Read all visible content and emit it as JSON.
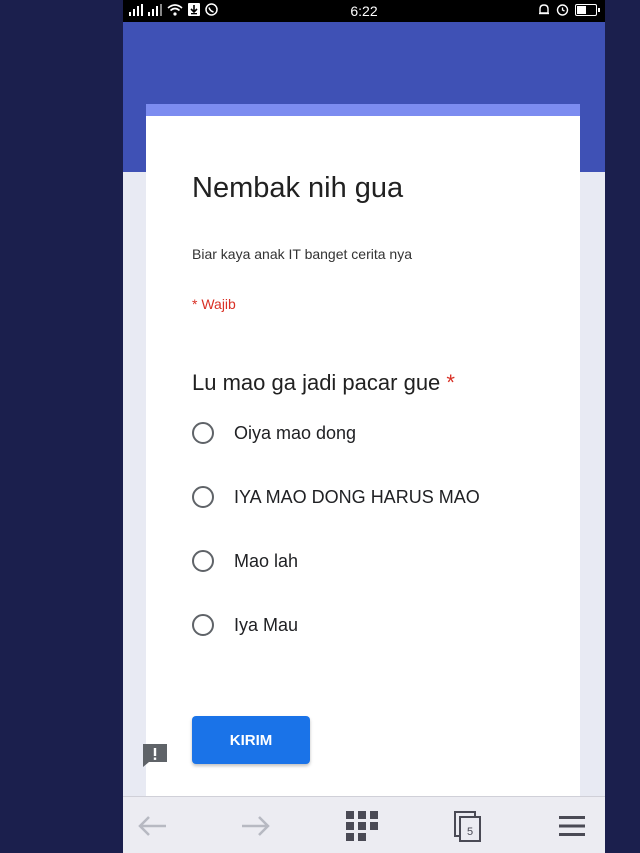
{
  "status_bar": {
    "time": "6:22",
    "left_icons": [
      "signal-icon",
      "signal-icon",
      "wifi-icon",
      "download-icon",
      "whatsapp-icon"
    ],
    "right_icons": [
      "bell-icon",
      "alarm-icon",
      "battery-icon"
    ]
  },
  "form": {
    "title": "Nembak nih gua",
    "description": "Biar kaya anak IT banget cerita nya",
    "required_note": "* Wajib",
    "question": {
      "text": "Lu mao ga jadi pacar gue",
      "required_mark": "*",
      "options": [
        {
          "label": "Oiya mao dong",
          "selected": false
        },
        {
          "label": "IYA MAO DONG HARUS MAO",
          "selected": false
        },
        {
          "label": "Mao lah",
          "selected": false
        },
        {
          "label": "Iya Mau",
          "selected": false
        }
      ]
    },
    "submit_label": "KIRIM"
  },
  "navbar": {
    "tab_count": "5",
    "buttons": [
      "back-arrow-icon",
      "forward-arrow-icon",
      "grid-icon",
      "tabs-icon",
      "menu-icon"
    ]
  },
  "colors": {
    "header": "#3f51b5",
    "accent_strip": "#7c8cf0",
    "required": "#d93025",
    "button": "#1a73e8",
    "outer_background": "#1b1f4d"
  }
}
